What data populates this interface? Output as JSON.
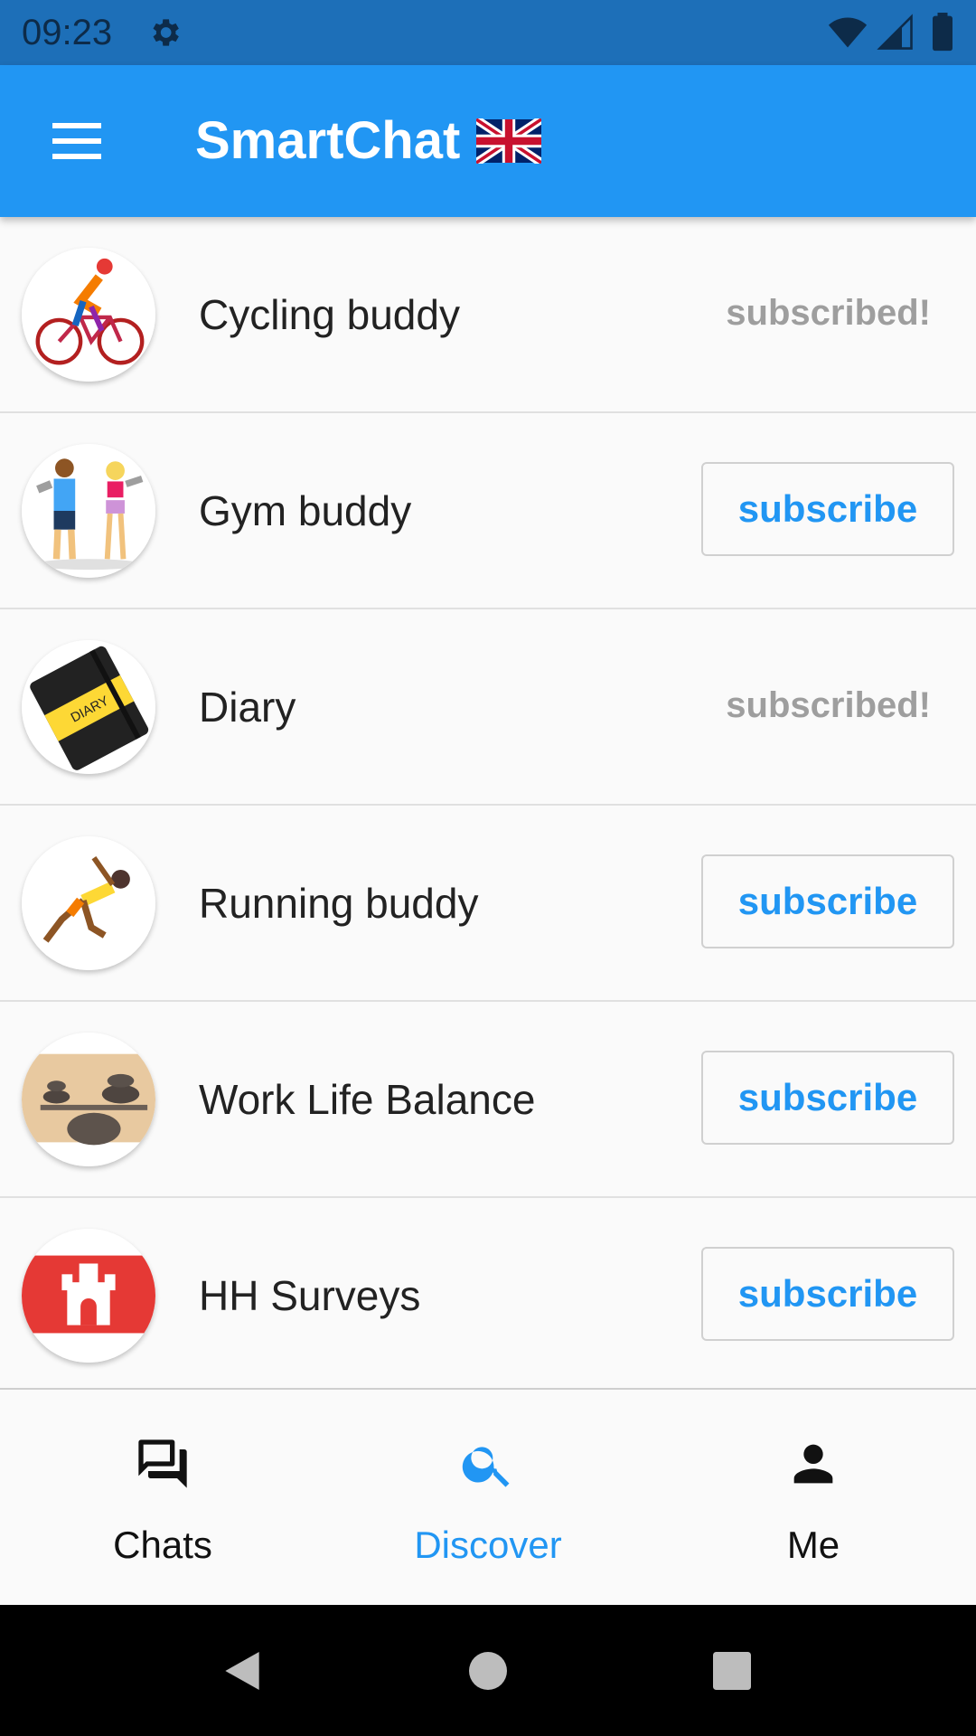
{
  "status_bar": {
    "time": "09:23",
    "icons": [
      "gear-icon",
      "wifi-icon",
      "signal-icon",
      "battery-icon"
    ],
    "color": "#1d6fb8"
  },
  "app_bar": {
    "title": "SmartChat",
    "flag_icon": "uk-flag-icon",
    "menu_icon": "hamburger-menu-icon",
    "color": "#2196f3"
  },
  "subscriptions": [
    {
      "label": "Cycling buddy",
      "status": "subscribed!",
      "avatar": "cyclist-avatar"
    },
    {
      "label": "Gym buddy",
      "status": "subscribe",
      "avatar": "gym-avatar"
    },
    {
      "label": "Diary",
      "status": "subscribed!",
      "avatar": "diary-avatar"
    },
    {
      "label": "Running buddy",
      "status": "subscribe",
      "avatar": "runner-avatar"
    },
    {
      "label": "Work Life Balance",
      "status": "subscribe",
      "avatar": "balance-stones-avatar"
    },
    {
      "label": "HH Surveys",
      "status": "subscribe",
      "avatar": "hamburg-flag-avatar"
    }
  ],
  "bottom_nav": {
    "items": [
      {
        "label": "Chats",
        "icon": "chats-icon",
        "active": false
      },
      {
        "label": "Discover",
        "icon": "search-icon",
        "active": true
      },
      {
        "label": "Me",
        "icon": "person-icon",
        "active": false
      }
    ],
    "active_color": "#2196f3"
  },
  "system_nav": {
    "icons": [
      "back-icon",
      "home-icon",
      "recents-icon"
    ]
  }
}
